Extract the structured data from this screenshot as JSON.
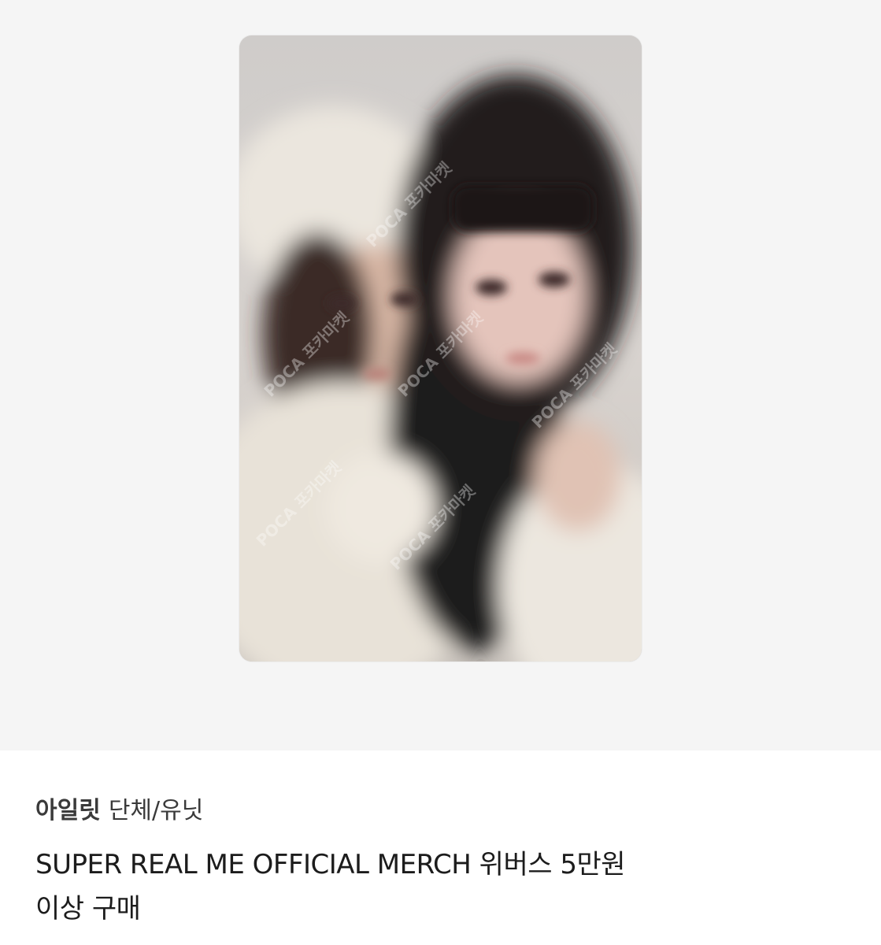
{
  "listing": {
    "artist": "아일릿",
    "group_type": "단체/유닛",
    "title_line1": "SUPER REAL ME OFFICIAL MERCH 위버스 5만원",
    "title_line2": "이상 구매"
  },
  "photo": {
    "watermark_text": "POCA 포카마켓",
    "background_color": "#f5f5f5"
  }
}
